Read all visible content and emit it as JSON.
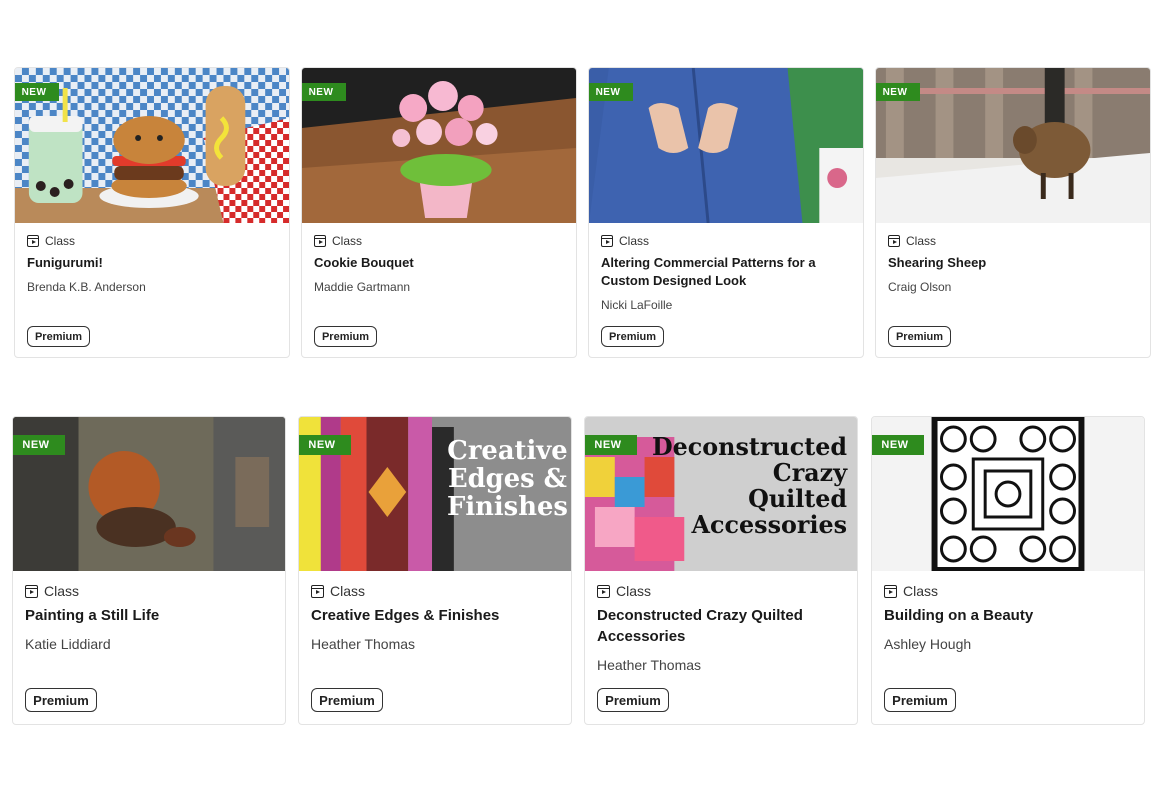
{
  "cards": [
    {
      "badge": "NEW",
      "type": "Class",
      "title": "Funigurumi!",
      "author": "Brenda K.B. Anderson",
      "tag": "Premium",
      "image_icon": "crochet-food-image"
    },
    {
      "badge": "NEW",
      "type": "Class",
      "title": "Cookie Bouquet",
      "author": "Maddie Gartmann",
      "tag": "Premium",
      "image_icon": "cookie-bouquet-image"
    },
    {
      "badge": "NEW",
      "type": "Class",
      "title": "Altering Commercial Patterns for a Custom Designed Look",
      "author": "Nicki LaFoille",
      "tag": "Premium",
      "image_icon": "shirt-pattern-image"
    },
    {
      "badge": "NEW",
      "type": "Class",
      "title": "Shearing Sheep",
      "author": "Craig Olson",
      "tag": "Premium",
      "image_icon": "sheep-barn-image"
    },
    {
      "badge": "NEW",
      "type": "Class",
      "title": "Painting a Still Life",
      "author": "Katie Liddiard",
      "tag": "Premium",
      "image_icon": "still-life-painting-image"
    },
    {
      "badge": "NEW",
      "type": "Class",
      "title": "Creative Edges & Finishes",
      "author": "Heather Thomas",
      "tag": "Premium",
      "image_text": "Creative Edges & Finishes",
      "image_icon": "quilt-edges-image"
    },
    {
      "badge": "NEW",
      "type": "Class",
      "title": "Deconstructed Crazy Quilted Accessories",
      "author": "Heather Thomas",
      "tag": "Premium",
      "image_text": "Deconstructed Crazy Quilted Accessories",
      "image_icon": "crazy-quilt-image"
    },
    {
      "badge": "NEW",
      "type": "Class",
      "title": "Building on a Beauty",
      "author": "Ashley Hough",
      "tag": "Premium",
      "image_icon": "quilt-block-image"
    }
  ],
  "colors": {
    "badge_green": "#2e8b1e",
    "border": "#e3e3e3"
  }
}
